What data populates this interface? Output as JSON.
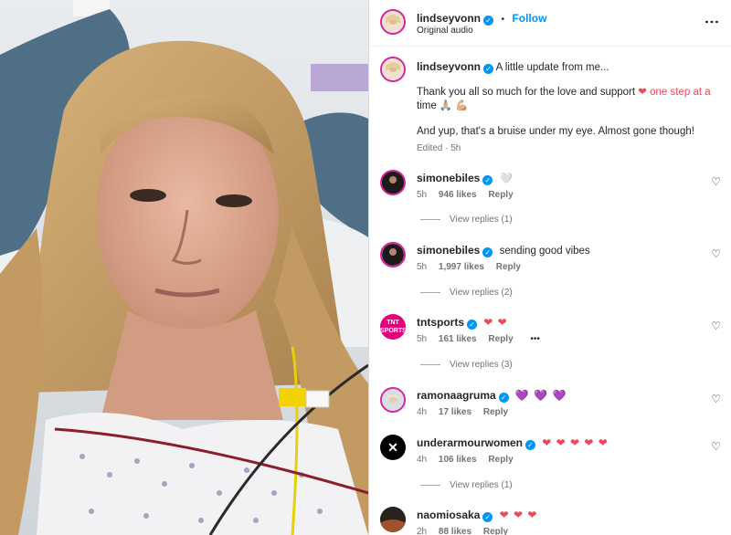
{
  "post": {
    "username": "lindseyvonn",
    "follow_label": "Follow",
    "audio": "Original audio",
    "more": "⋮"
  },
  "caption": {
    "username": "lindseyvonn",
    "line1": "A little update from me...",
    "line2": "Thank you all so much for the love and support",
    "line2_emoji": "❤ one step at a",
    "line3": "time 🙏🏼 💪🏼",
    "line4": "And yup, that's a bruise under my eye. Almost gone though!",
    "edited": "Edited · 5h"
  },
  "comments": [
    {
      "username": "simonebiles",
      "text": "🤍",
      "time": "5h",
      "likes": "946 likes",
      "reply": "Reply",
      "view_replies": "View replies (1)"
    },
    {
      "username": "simonebiles",
      "text": "sending good vibes",
      "time": "5h",
      "likes": "1,997 likes",
      "reply": "Reply",
      "view_replies": "View replies (2)"
    },
    {
      "username": "tntsports",
      "text": "❤ ❤",
      "time": "5h",
      "likes": "161 likes",
      "reply": "Reply",
      "more": "•••",
      "view_replies": "View replies (3)",
      "avatar_text": "TNT SPORTS"
    },
    {
      "username": "ramonaagruma",
      "text": "💜 💜 💜",
      "time": "4h",
      "likes": "17 likes",
      "reply": "Reply"
    },
    {
      "username": "underarmourwomen",
      "text": "❤ ❤ ❤ ❤ ❤",
      "time": "4h",
      "likes": "106 likes",
      "reply": "Reply",
      "view_replies": "View replies (1)"
    },
    {
      "username": "naomiosaka",
      "text": "❤ ❤ ❤",
      "time": "2h",
      "likes": "88 likes",
      "reply": "Reply"
    }
  ],
  "colors": {
    "accent": "#0095f6",
    "heart": "#ed4956",
    "tnt": "#e4007c"
  }
}
